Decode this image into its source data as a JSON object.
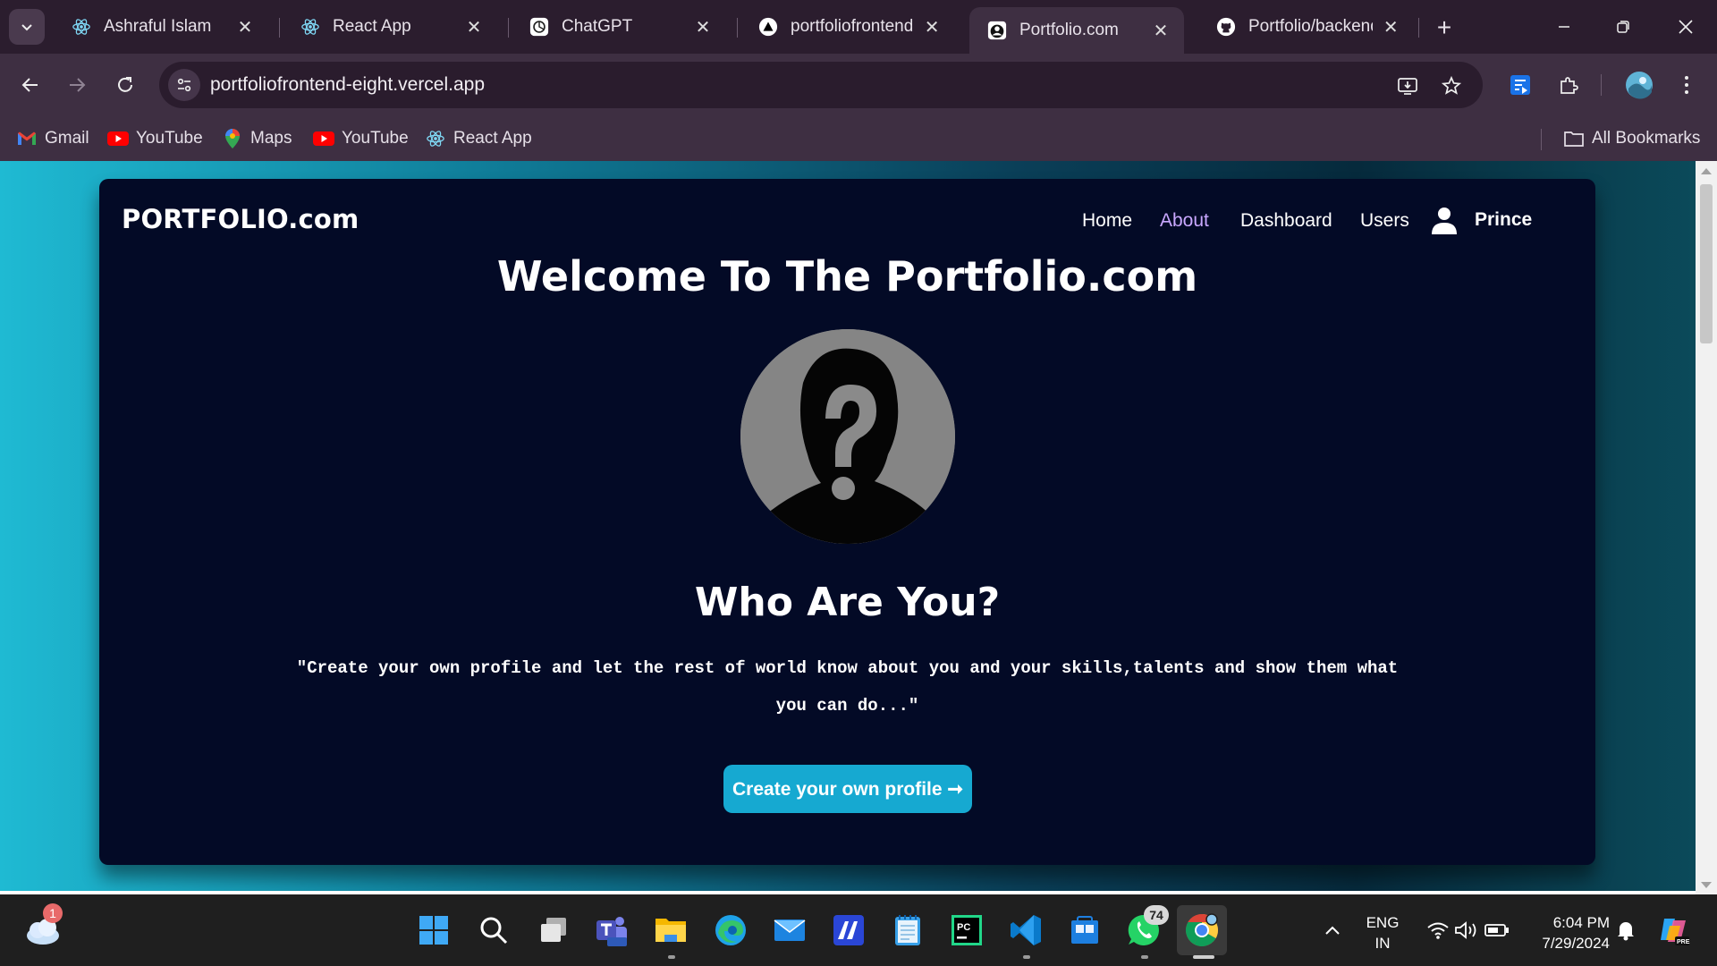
{
  "browser": {
    "tabs": [
      {
        "label": "Ashraful Islam",
        "icon": "react-icon",
        "active": false
      },
      {
        "label": "React App",
        "icon": "react-icon",
        "active": false
      },
      {
        "label": "ChatGPT",
        "icon": "chatgpt-icon",
        "active": false
      },
      {
        "label": "portfoliofrontend",
        "icon": "vercel-icon",
        "active": false
      },
      {
        "label": "Portfolio.com",
        "icon": "portfolio-icon",
        "active": true
      },
      {
        "label": "Portfolio/backend/",
        "icon": "github-icon",
        "active": false
      }
    ],
    "close_glyph": "✕",
    "newtab_glyph": "+",
    "url": "portfoliofrontend-eight.vercel.app",
    "bookmarks": [
      {
        "label": "Gmail",
        "icon": "gmail-icon"
      },
      {
        "label": "YouTube",
        "icon": "youtube-icon"
      },
      {
        "label": "Maps",
        "icon": "maps-icon"
      },
      {
        "label": "YouTube",
        "icon": "youtube-icon"
      },
      {
        "label": "React App",
        "icon": "react-icon"
      }
    ],
    "all_bookmarks": "All Bookmarks",
    "accent": "#3e2f42"
  },
  "page": {
    "brand": "PORTFOLIO.com",
    "nav": [
      {
        "label": "Home",
        "active": false
      },
      {
        "label": "About",
        "active": true
      },
      {
        "label": "Dashboard",
        "active": false
      },
      {
        "label": "Users",
        "active": false
      }
    ],
    "user_name": "Prince",
    "headline": "Welcome To The Portfolio.com",
    "subheading": "Who Are You?",
    "quote_line1": "\"Create your own profile and let the rest of world know about you and your skills,talents and show them what",
    "quote_line2": "you can do...\"",
    "cta_label": "Create your own profile ➞",
    "colors": {
      "card": "#030a26",
      "active_nav": "#c9a8ff",
      "cta": "#16a9d1"
    }
  },
  "taskbar": {
    "weather_badge": "1",
    "whatsapp_badge": "74",
    "language": "ENG",
    "region": "IN",
    "time": "6:04 PM",
    "date": "7/29/2024",
    "apps": [
      "windows-start-icon",
      "search-icon",
      "task-view-icon",
      "teams-icon",
      "file-explorer-icon",
      "edge-icon",
      "mail-icon",
      "ai-app-icon",
      "notepad-icon",
      "pycharm-icon",
      "vscode-icon",
      "store-icon",
      "whatsapp-icon",
      "chrome-icon"
    ]
  }
}
